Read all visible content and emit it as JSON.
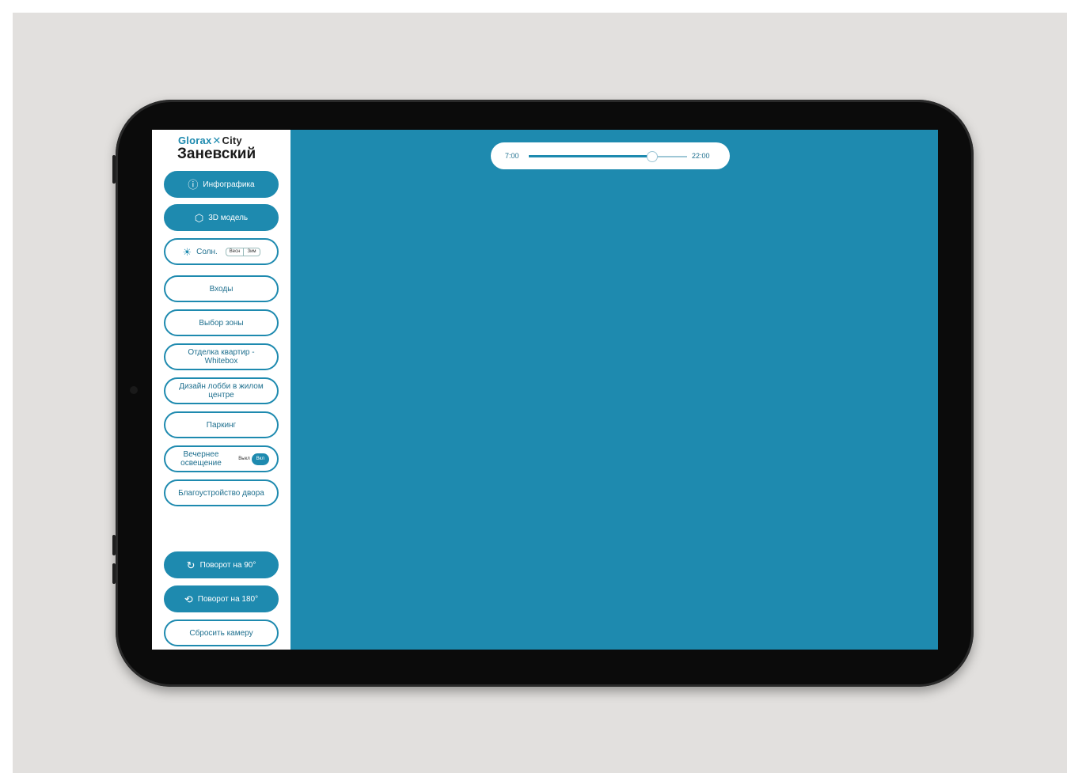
{
  "brand": {
    "logo_left": "Glorax",
    "logo_mark": "✕",
    "logo_right": "City",
    "project": "Заневский"
  },
  "menu": {
    "infographics": {
      "label": "Инфографика",
      "icon": "info-icon"
    },
    "model3d": {
      "label": "3D модель",
      "icon": "cube-icon"
    },
    "sun": {
      "label": "Солн.",
      "icon": "sun-calendar-icon",
      "toggle": [
        "Весн",
        "Зим"
      ]
    },
    "entries": {
      "label": "Входы"
    },
    "zones": {
      "label": "Выбор зоны"
    },
    "finishing": {
      "label": "Отделка квартир - Whitebox"
    },
    "design": {
      "label": "Дизайн лобби в жилом центре"
    },
    "parking": {
      "label": "Паркинг"
    },
    "lighting": {
      "label": "Вечернее освещение",
      "switch_off": "Выкл",
      "switch_on": "Вкл"
    },
    "landscaping": {
      "label": "Благоустройство двора"
    },
    "rotate90": {
      "label": "Поворот на 90°",
      "icon": "rotate-icon"
    },
    "rotate180": {
      "label": "Поворот на 180°",
      "icon": "rotate-180-icon"
    },
    "reset": {
      "label": "Сбросить камеру"
    }
  },
  "time_slider": {
    "min_label": "7:00",
    "max_label": "22:00",
    "value_fraction": 0.78
  },
  "colors": {
    "accent": "#1e8aaf",
    "viewport": "#1e8aaf",
    "backdrop": "#e2e0de",
    "bezel": "#0b0b0b"
  }
}
